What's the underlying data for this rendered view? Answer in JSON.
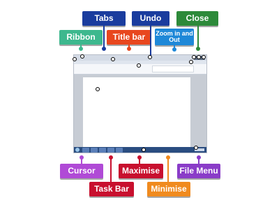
{
  "labels": {
    "tabs": "Tabs",
    "undo": "Undo",
    "close": "Close",
    "ribbon": "Ribbon",
    "title_bar": "Title bar",
    "zoom": "Zoom in and Out",
    "cursor": "Cursor",
    "task_bar": "Task Bar",
    "maximise": "Maximise",
    "minimise": "Minimise",
    "file_menu": "File Menu"
  },
  "colors": {
    "tabs": "#1a3c9e",
    "undo": "#1a3c9e",
    "close": "#2d8a3a",
    "ribbon": "#3db88e",
    "title_bar": "#e8471e",
    "zoom": "#1e88d8",
    "cursor": "#b04ad6",
    "task_bar": "#c8102e",
    "maximise": "#c8102e",
    "minimise": "#f08a1e",
    "file_menu": "#8a3cc8"
  }
}
